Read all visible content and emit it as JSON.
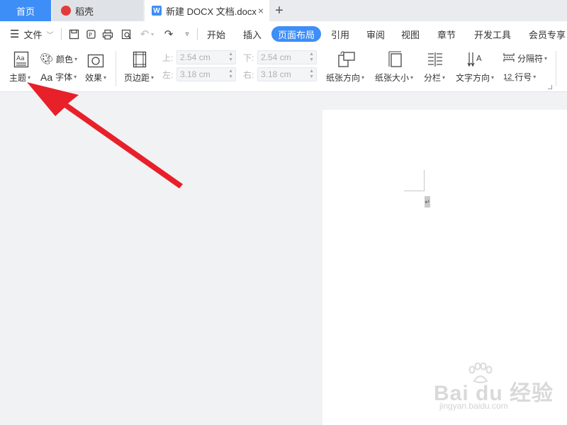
{
  "tabbar": {
    "home": "首页",
    "daoke": "稻壳",
    "doc_icon": "W",
    "doc_title": "新建 DOCX 文档.docx",
    "close": "×",
    "add": "+"
  },
  "menu": {
    "file": "文件",
    "tabs": [
      "开始",
      "插入",
      "页面布局",
      "引用",
      "审阅",
      "视图",
      "章节",
      "开发工具",
      "会员专享"
    ],
    "active_tab": "页面布局"
  },
  "ribbon": {
    "theme": "主题",
    "color": "颜色",
    "font": "字体",
    "font_prefix": "Aa",
    "effect": "效果",
    "margins": "页边距",
    "top_label": "上:",
    "top_value": "2.54 cm",
    "bottom_label": "下:",
    "bottom_value": "2.54 cm",
    "left_label": "左:",
    "left_value": "3.18 cm",
    "right_label": "右:",
    "right_value": "3.18 cm",
    "orientation": "纸张方向",
    "size": "纸张大小",
    "columns": "分栏",
    "text_direction": "文字方向",
    "breaks": "分隔符",
    "line_numbers": "行号",
    "theme_icon_text": "Aa"
  },
  "document": {
    "paragraph_mark": "↵"
  },
  "watermark": {
    "brand": "Bai du 经验",
    "url": "jingyan.baidu.com"
  },
  "colors": {
    "accent": "#3e8ef7",
    "arrow": "#e8202a",
    "tabbar_bg": "#e9ebee",
    "canvas_bg": "#f1f2f4"
  },
  "icons": [
    "hamburger-icon",
    "save-icon",
    "export-icon",
    "print-icon",
    "preview-icon",
    "undo-icon",
    "redo-icon",
    "more-icon",
    "palette-icon",
    "effect-icon",
    "margins-icon",
    "orientation-icon",
    "size-icon",
    "columns-icon",
    "text-direction-icon",
    "breaks-icon",
    "line-number-icon",
    "red-arrow-annotation"
  ]
}
